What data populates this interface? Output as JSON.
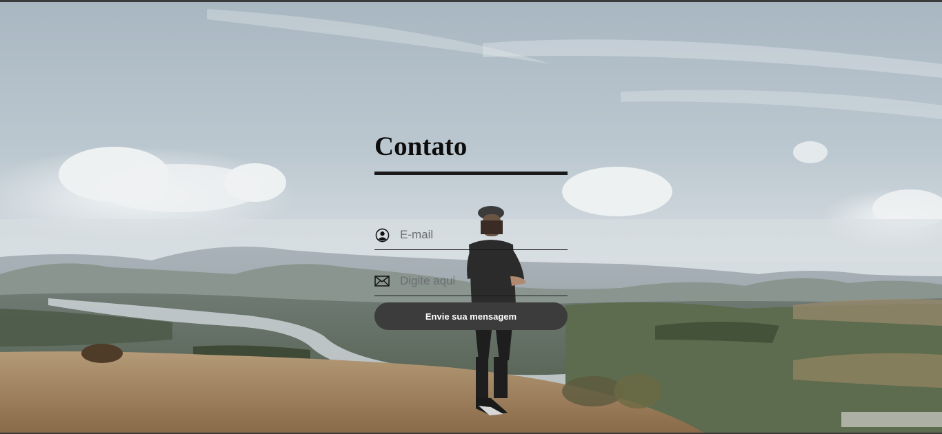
{
  "contact": {
    "title": "Contato",
    "email_placeholder": "E-mail",
    "message_placeholder": "Digite aqui",
    "submit_label": "Envie sua mensagem"
  },
  "icons": {
    "email_field_icon": "user-circle-icon",
    "message_field_icon": "envelope-icon"
  },
  "colors": {
    "title": "#0d0d0d",
    "underline": "#1a1a1a",
    "button_bg": "#3c3c3c",
    "button_text": "#ffffff",
    "placeholder": "#6a6e72"
  }
}
